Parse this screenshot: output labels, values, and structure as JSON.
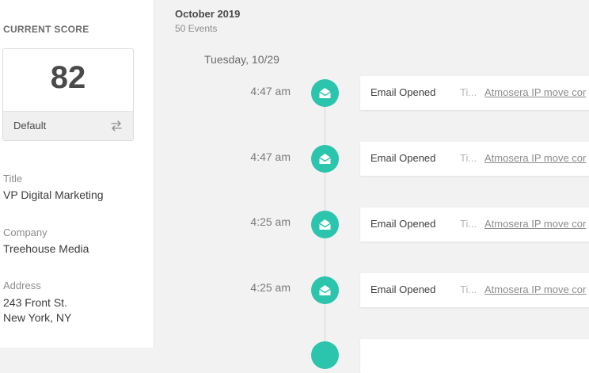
{
  "sidebar": {
    "score_heading": "CURRENT SCORE",
    "score_value": "82",
    "score_model": "Default",
    "fields": [
      {
        "label": "Title",
        "value": "VP Digital Marketing"
      },
      {
        "label": "Company",
        "value": "Treehouse Media"
      },
      {
        "label": "Address",
        "value_line1": "243 Front St.",
        "value_line2": "New York, NY"
      }
    ]
  },
  "timeline": {
    "month": "October 2019",
    "event_count": "50 Events",
    "day": "Tuesday, 10/29",
    "events": [
      {
        "time": "4:47 am",
        "type": "Email Opened",
        "truncated": "Ti...",
        "link": "Atmosera IP move cor"
      },
      {
        "time": "4:47 am",
        "type": "Email Opened",
        "truncated": "Ti...",
        "link": "Atmosera IP move cor"
      },
      {
        "time": "4:25 am",
        "type": "Email Opened",
        "truncated": "Ti...",
        "link": "Atmosera IP move cor"
      },
      {
        "time": "4:25 am",
        "type": "Email Opened",
        "truncated": "Ti...",
        "link": "Atmosera IP move cor"
      }
    ]
  },
  "colors": {
    "accent": "#2bc4ad",
    "background": "#f2f2f2",
    "card": "#ffffff"
  },
  "icons": {
    "event": "email-opened-icon",
    "score_toggle": "swap-arrows-icon"
  }
}
